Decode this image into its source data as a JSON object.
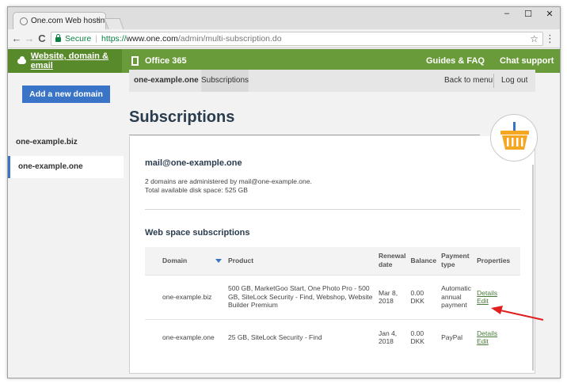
{
  "browser": {
    "tab_title": "One.com Web hosting",
    "tab_close": "×",
    "window_minimize": "–",
    "window_restore": "☐",
    "window_close": "✕",
    "back": "←",
    "forward": "→",
    "reload": "C",
    "secure_label": "Secure",
    "url_scheme": "https://",
    "url_host": "www.one.com",
    "url_path": "/admin/multi-subscription.do",
    "bookmark_star": "☆",
    "menu": "⋮"
  },
  "top_nav": {
    "website_domain_email": "Website, domain & email",
    "office365": "Office 365",
    "guides_faq": "Guides & FAQ",
    "chat_support": "Chat support"
  },
  "sidebar": {
    "add_domain": "Add a new domain",
    "domains": [
      {
        "label": "one-example.biz",
        "active": false
      },
      {
        "label": "one-example.one",
        "active": true
      }
    ]
  },
  "subnav": {
    "domain": "one-example.one",
    "tab": "Subscriptions",
    "back": "Back to menu",
    "logout": "Log out"
  },
  "page": {
    "title": "Subscriptions",
    "mail_title": "mail@one-example.one",
    "mail_line1": "2 domains are administered by mail@one-example.one.",
    "mail_line2": "Total available disk space: 525 GB",
    "ws_title": "Web space subscriptions"
  },
  "table": {
    "headers": {
      "domain": "Domain",
      "product": "Product",
      "renewal_1": "Renewal",
      "renewal_2": "date",
      "balance": "Balance",
      "payment_1": "Payment",
      "payment_2": "type",
      "properties": "Properties"
    },
    "rows": [
      {
        "domain": "one-example.biz",
        "product": "500 GB, MarketGoo Start, One Photo Pro - 500 GB, SiteLock Security - Find, Webshop, Website Builder Premium",
        "renewal_1": "Mar 8,",
        "renewal_2": "2018",
        "balance_1": "0.00",
        "balance_2": "DKK",
        "payment": "Automatic annual payment",
        "details": "Details",
        "edit": "Edit"
      },
      {
        "domain": "one-example.one",
        "product": "25 GB, SiteLock Security - Find",
        "renewal_1": "Jan 4,",
        "renewal_2": "2018",
        "balance_1": "0.00",
        "balance_2": "DKK",
        "payment": "PayPal",
        "details": "Details",
        "edit": "Edit"
      }
    ]
  },
  "colors": {
    "green_nav": "#6a9b3a",
    "green_nav_dark": "#588a2b",
    "button_blue": "#3a74c6",
    "link_green": "#4a7a3a",
    "basket_orange": "#f5a623",
    "annotation_red": "#e02020"
  }
}
